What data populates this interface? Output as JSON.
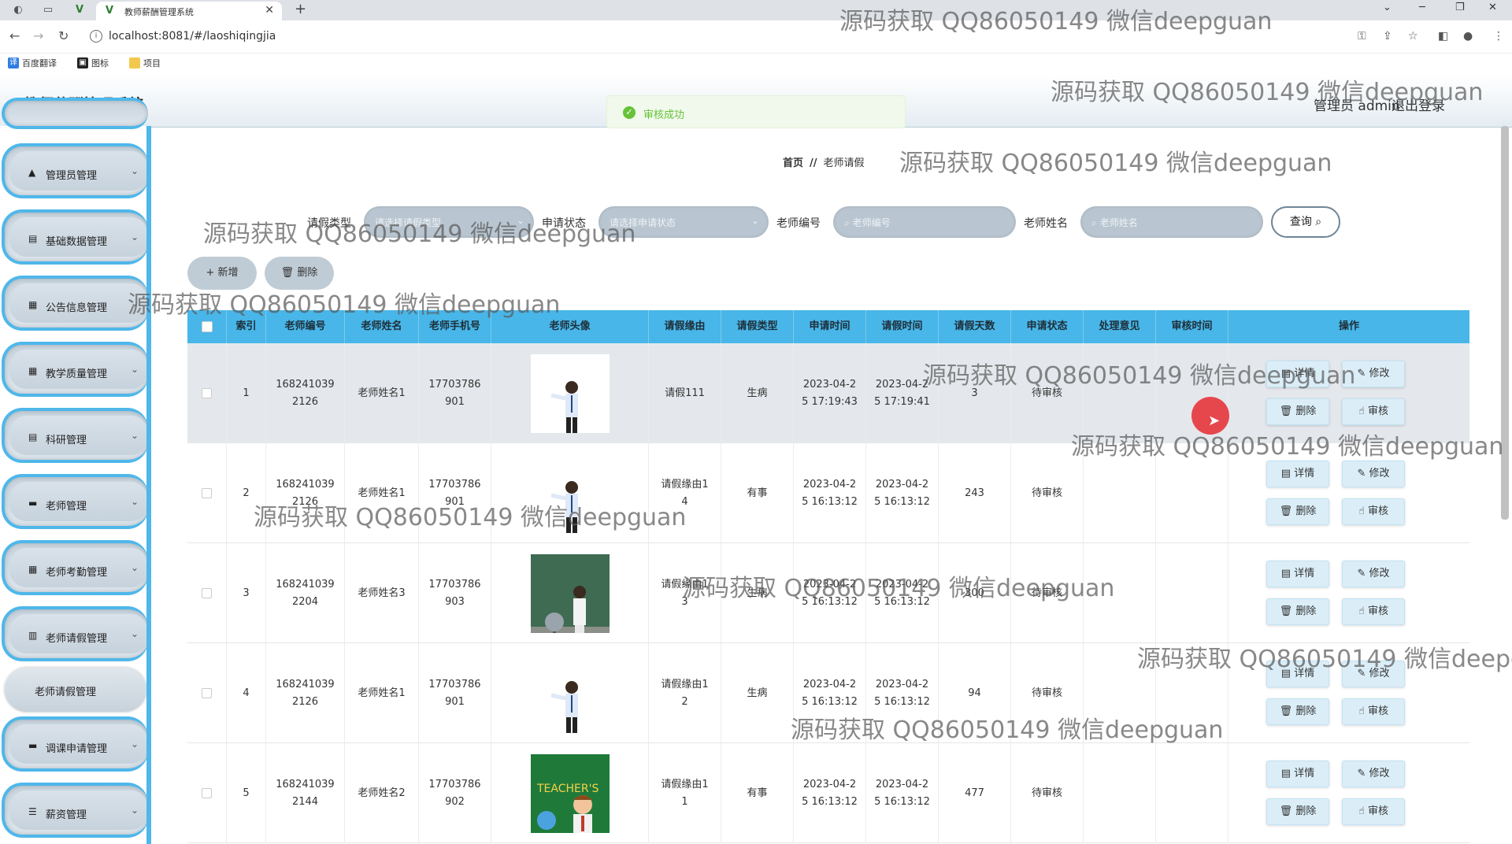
{
  "browser": {
    "tab_title": "教师薪酬管理系统",
    "url": "localhost:8081/#/laoshiqingjia",
    "bookmarks": [
      "百度翻译",
      "图标",
      "项目"
    ]
  },
  "app": {
    "title": "教师薪酬管理系统",
    "admin_label": "管理员 admin",
    "logout_label": "退出登录",
    "toast_message": "审核成功"
  },
  "sidebar": {
    "items": [
      {
        "label": "管理员管理",
        "icon": "user-icon"
      },
      {
        "label": "基础数据管理",
        "icon": "clipboard-icon"
      },
      {
        "label": "公告信息管理",
        "icon": "grid-icon"
      },
      {
        "label": "教学质量管理",
        "icon": "grid-icon"
      },
      {
        "label": "科研管理",
        "icon": "clipboard-icon"
      },
      {
        "label": "老师管理",
        "icon": "monitor-icon"
      },
      {
        "label": "老师考勤管理",
        "icon": "grid-icon"
      },
      {
        "label": "老师请假管理",
        "icon": "chart-icon"
      },
      {
        "label": "调课申请管理",
        "icon": "monitor-icon"
      },
      {
        "label": "薪资管理",
        "icon": "sliders-icon"
      }
    ],
    "active_sub": "老师请假管理"
  },
  "breadcrumb": {
    "home": "首页",
    "separator": "//",
    "current": "老师请假"
  },
  "search": {
    "leave_type_label": "请假类型",
    "leave_type_placeholder": "请选择请假类型",
    "status_label": "申请状态",
    "status_placeholder": "请选择申请状态",
    "teacher_no_label": "老师编号",
    "teacher_no_placeholder": "老师编号",
    "teacher_name_label": "老师姓名",
    "teacher_name_placeholder": "老师姓名",
    "query_label": "查询"
  },
  "actions": {
    "add_label": "+ 新增",
    "delete_label": "删除"
  },
  "table": {
    "headers": [
      "索引",
      "老师编号",
      "老师姓名",
      "老师手机号",
      "老师头像",
      "请假缘由",
      "请假类型",
      "申请时间",
      "请假时间",
      "请假天数",
      "申请状态",
      "处理意见",
      "审核时间",
      "操作"
    ],
    "rows": [
      {
        "index": "1",
        "teacher_no": "168241039\n2126",
        "name": "老师姓名1",
        "phone": "17703786\n901",
        "reason": "请假111",
        "type": "生病",
        "apply_time": "2023-04-2\n5 17:19:43",
        "leave_time": "2023-04-2\n5 17:19:41",
        "days": "3",
        "status": "待审核",
        "opinion": "",
        "audit_time": ""
      },
      {
        "index": "2",
        "teacher_no": "168241039\n2126",
        "name": "老师姓名1",
        "phone": "17703786\n901",
        "reason": "请假缘由1\n4",
        "type": "有事",
        "apply_time": "2023-04-2\n5 16:13:12",
        "leave_time": "2023-04-2\n5 16:13:12",
        "days": "243",
        "status": "待审核",
        "opinion": "",
        "audit_time": ""
      },
      {
        "index": "3",
        "teacher_no": "168241039\n2204",
        "name": "老师姓名3",
        "phone": "17703786\n903",
        "reason": "请假缘由1\n3",
        "type": "生病",
        "apply_time": "2023-04-2\n5 16:13:12",
        "leave_time": "2023-04-2\n5 16:13:12",
        "days": "300",
        "status": "待审核",
        "opinion": "",
        "audit_time": ""
      },
      {
        "index": "4",
        "teacher_no": "168241039\n2126",
        "name": "老师姓名1",
        "phone": "17703786\n901",
        "reason": "请假缘由1\n2",
        "type": "生病",
        "apply_time": "2023-04-2\n5 16:13:12",
        "leave_time": "2023-04-2\n5 16:13:12",
        "days": "94",
        "status": "待审核",
        "opinion": "",
        "audit_time": ""
      },
      {
        "index": "5",
        "teacher_no": "168241039\n2144",
        "name": "老师姓名2",
        "phone": "17703786\n902",
        "reason": "请假缘由1\n1",
        "type": "有事",
        "apply_time": "2023-04-2\n5 16:13:12",
        "leave_time": "2023-04-2\n5 16:13:12",
        "days": "477",
        "status": "待审核",
        "opinion": "",
        "audit_time": ""
      }
    ],
    "op_labels": {
      "detail": "详情",
      "edit": "修改",
      "delete": "删除",
      "audit": "审核"
    }
  },
  "watermark": "源码获取 QQ86050149 微信deepguan",
  "watermark_cut": "源码获取 QQ86050149 微信deepg",
  "colors": {
    "accent": "#48b6e8",
    "success": "#67c23a"
  }
}
